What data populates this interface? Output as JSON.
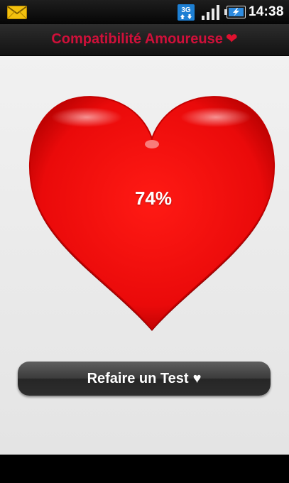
{
  "status_bar": {
    "time": "14:38",
    "network_label": "3G",
    "icons": [
      "mail-icon",
      "network-3g-icon",
      "signal-icon",
      "battery-charging-icon"
    ]
  },
  "app": {
    "title": "Compatibilité Amoureuse",
    "title_heart": "❤"
  },
  "result": {
    "percent_label": "74%"
  },
  "actions": {
    "retest_label": "Refaire un Test",
    "retest_heart": "♥"
  },
  "colors": {
    "title_accent": "#d0103a",
    "heart": "#e8080a"
  }
}
